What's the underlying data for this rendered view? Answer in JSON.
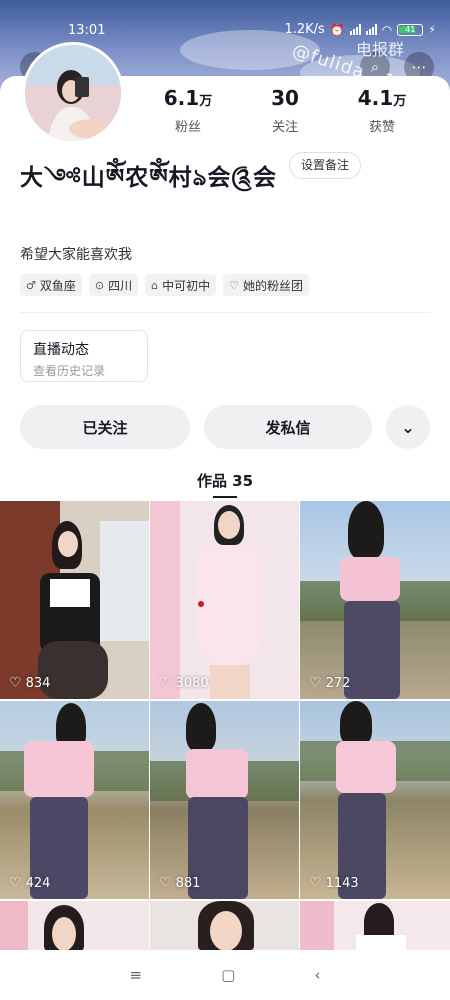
{
  "status": {
    "time": "13:01",
    "network_speed": "1.2K/s",
    "battery": "41"
  },
  "watermark": "@fulida...1024",
  "watermark_top": "电报群",
  "profile": {
    "nickname": "大༺山ༀ农ༀ村ঌ会༊会",
    "remark_button": "设置备注",
    "stats": [
      {
        "value": "6.1",
        "unit": "万",
        "label": "粉丝"
      },
      {
        "value": "30",
        "unit": "",
        "label": "关注"
      },
      {
        "value": "4.1",
        "unit": "万",
        "label": "获赞"
      }
    ],
    "bio": "希望大家能喜欢我",
    "tags": [
      {
        "icon": "gender-icon",
        "glyph": "♂",
        "label": "双鱼座"
      },
      {
        "icon": "location-icon",
        "glyph": "⊙",
        "label": "四川"
      },
      {
        "icon": "school-icon",
        "glyph": "⌂",
        "label": "中可初中"
      },
      {
        "icon": "fan-group-icon",
        "glyph": "♡",
        "label": "她的粉丝团"
      }
    ],
    "live_card": {
      "title": "直播动态",
      "subtitle": "查看历史记录"
    },
    "buttons": {
      "follow": "已关注",
      "message": "发私信",
      "more": "⌄"
    }
  },
  "works": {
    "tab_label": "作品 35",
    "items": [
      {
        "likes": "834"
      },
      {
        "likes": "3080"
      },
      {
        "likes": "272"
      },
      {
        "likes": "424"
      },
      {
        "likes": "881"
      },
      {
        "likes": "1143"
      },
      {
        "likes": ""
      },
      {
        "likes": ""
      },
      {
        "likes": ""
      }
    ]
  },
  "colors": {
    "accent_text": "#161823",
    "button_bg": "#f0f0f2",
    "header_gradient_top": "#3f5c9c"
  }
}
